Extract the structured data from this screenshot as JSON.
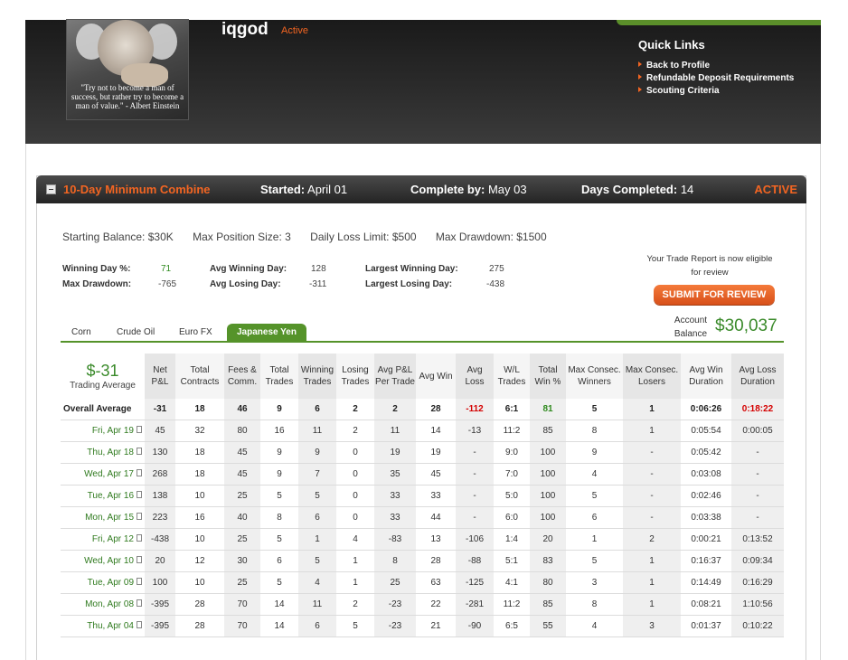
{
  "user": {
    "name": "iqgod",
    "status": "Active",
    "avatar_quote": "\"Try not to become a man of success, but rather try to become a man of value.\" - Albert Einstein"
  },
  "quick_links": {
    "title": "Quick Links",
    "items": [
      "Back to Profile",
      "Refundable Deposit Requirements",
      "Scouting Criteria"
    ]
  },
  "combine": {
    "title": "10-Day Minimum Combine",
    "started_label": "Started:",
    "started_value": "April 01",
    "complete_label": "Complete by:",
    "complete_value": "May 03",
    "days_label": "Days Completed:",
    "days_value": "14",
    "status": "ACTIVE"
  },
  "rules": {
    "starting_balance": "Starting Balance: $30K",
    "max_position": "Max Position Size: 3",
    "daily_loss": "Daily Loss Limit: $500",
    "max_drawdown": "Max Drawdown: $1500"
  },
  "stats": {
    "winning_day_pct_label": "Winning Day %:",
    "winning_day_pct": "71",
    "max_drawdown_label": "Max Drawdown:",
    "max_drawdown": "-765",
    "avg_winning_day_label": "Avg Winning Day:",
    "avg_winning_day": "128",
    "avg_losing_day_label": "Avg Losing Day:",
    "avg_losing_day": "-311",
    "largest_winning_day_label": "Largest Winning Day:",
    "largest_winning_day": "275",
    "largest_losing_day_label": "Largest Losing Day:",
    "largest_losing_day": "-438"
  },
  "review": {
    "note": "Your Trade Report is now eligible for review",
    "button": "SUBMIT FOR REVIEW"
  },
  "tabs": [
    "Corn",
    "Crude Oil",
    "Euro FX",
    "Japanese Yen"
  ],
  "active_tab": "Japanese Yen",
  "account": {
    "label": "Account Balance",
    "value": "$30,037"
  },
  "table": {
    "summary_value": "$-31",
    "summary_label": "Trading Average",
    "headers": [
      "Net P&L",
      "Total Contracts",
      "Fees & Comm.",
      "Total Trades",
      "Winning Trades",
      "Losing Trades",
      "Avg P&L Per Trade",
      "Avg Win",
      "Avg Loss",
      "W/L Trades",
      "Total Win %",
      "Max Consec. Winners",
      "Max Consec. Losers",
      "Avg Win Duration",
      "Avg Loss Duration"
    ],
    "average_row": {
      "label": "Overall Average",
      "cells": [
        "-31",
        "18",
        "46",
        "9",
        "6",
        "2",
        "2",
        "28",
        "-112",
        "6:1",
        "81",
        "5",
        "1",
        "0:06:26",
        "0:18:22"
      ]
    },
    "rows": [
      {
        "day": "Fri, Apr 19",
        "cells": [
          "45",
          "32",
          "80",
          "16",
          "11",
          "2",
          "11",
          "14",
          "-13",
          "11:2",
          "85",
          "8",
          "1",
          "0:05:54",
          "0:00:05"
        ]
      },
      {
        "day": "Thu, Apr 18",
        "cells": [
          "130",
          "18",
          "45",
          "9",
          "9",
          "0",
          "19",
          "19",
          "-",
          "9:0",
          "100",
          "9",
          "-",
          "0:05:42",
          "-"
        ]
      },
      {
        "day": "Wed, Apr 17",
        "cells": [
          "268",
          "18",
          "45",
          "9",
          "7",
          "0",
          "35",
          "45",
          "-",
          "7:0",
          "100",
          "4",
          "-",
          "0:03:08",
          "-"
        ]
      },
      {
        "day": "Tue, Apr 16",
        "cells": [
          "138",
          "10",
          "25",
          "5",
          "5",
          "0",
          "33",
          "33",
          "-",
          "5:0",
          "100",
          "5",
          "-",
          "0:02:46",
          "-"
        ]
      },
      {
        "day": "Mon, Apr 15",
        "cells": [
          "223",
          "16",
          "40",
          "8",
          "6",
          "0",
          "33",
          "44",
          "-",
          "6:0",
          "100",
          "6",
          "-",
          "0:03:38",
          "-"
        ]
      },
      {
        "day": "Fri, Apr 12",
        "cells": [
          "-438",
          "10",
          "25",
          "5",
          "1",
          "4",
          "-83",
          "13",
          "-106",
          "1:4",
          "20",
          "1",
          "2",
          "0:00:21",
          "0:13:52"
        ]
      },
      {
        "day": "Wed, Apr 10",
        "cells": [
          "20",
          "12",
          "30",
          "6",
          "5",
          "1",
          "8",
          "28",
          "-88",
          "5:1",
          "83",
          "5",
          "1",
          "0:16:37",
          "0:09:34"
        ]
      },
      {
        "day": "Tue, Apr 09",
        "cells": [
          "100",
          "10",
          "25",
          "5",
          "4",
          "1",
          "25",
          "63",
          "-125",
          "4:1",
          "80",
          "3",
          "1",
          "0:14:49",
          "0:16:29"
        ]
      },
      {
        "day": "Mon, Apr 08",
        "cells": [
          "-395",
          "28",
          "70",
          "14",
          "11",
          "2",
          "-23",
          "22",
          "-281",
          "11:2",
          "85",
          "8",
          "1",
          "0:08:21",
          "1:10:56"
        ]
      },
      {
        "day": "Thu, Apr 04",
        "cells": [
          "-395",
          "28",
          "70",
          "14",
          "6",
          "5",
          "-23",
          "21",
          "-90",
          "6:5",
          "55",
          "4",
          "3",
          "0:01:37",
          "0:10:22"
        ]
      }
    ]
  },
  "colors": {
    "accent": "#f26522",
    "green": "#55932a",
    "header_bg": "#2b2b2b",
    "loss_red": "#d40000"
  }
}
